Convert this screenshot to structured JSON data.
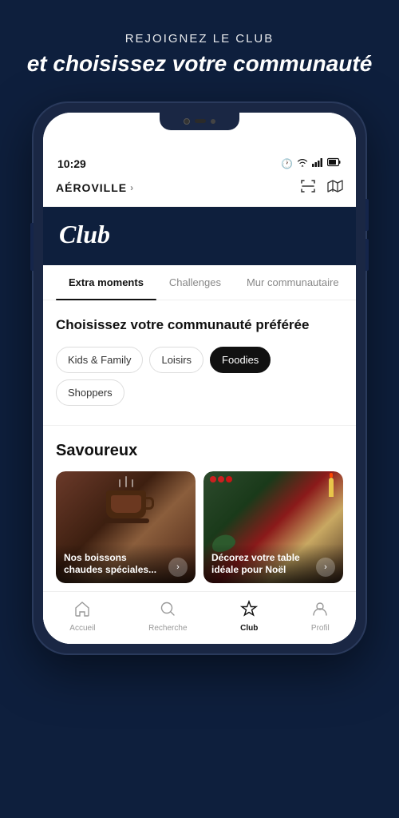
{
  "hero": {
    "subtitle": "REJOIGNEZ LE CLUB",
    "main_title": "et choisissez votre communauté"
  },
  "status_bar": {
    "time": "10:29",
    "icons": [
      "🕐",
      "📶",
      "🔋"
    ]
  },
  "address_bar": {
    "location": "AÉROVILLE",
    "chevron": "›"
  },
  "app_header": {
    "title": "Club"
  },
  "tabs": [
    {
      "label": "Extra moments",
      "active": true
    },
    {
      "label": "Challenges",
      "active": false
    },
    {
      "label": "Mur communautaire",
      "active": false
    }
  ],
  "community_section": {
    "title": "Choisissez votre communauté préférée",
    "chips": [
      {
        "label": "Kids & Family",
        "active": false
      },
      {
        "label": "Loisirs",
        "active": false
      },
      {
        "label": "Foodies",
        "active": true
      },
      {
        "label": "Shoppers",
        "active": false
      }
    ]
  },
  "savoureux_section": {
    "heading": "Savoureux",
    "cards": [
      {
        "text": "Nos boissons chaudes spéciales...",
        "arrow": "›"
      },
      {
        "text": "Décorez votre table idéale pour Noël",
        "arrow": "›"
      }
    ]
  },
  "bottom_nav": [
    {
      "label": "Accueil",
      "icon": "⌂",
      "active": false
    },
    {
      "label": "Recherche",
      "icon": "○",
      "active": false
    },
    {
      "label": "Club",
      "icon": "☆",
      "active": true
    },
    {
      "label": "Profil",
      "icon": "♟",
      "active": false
    }
  ]
}
